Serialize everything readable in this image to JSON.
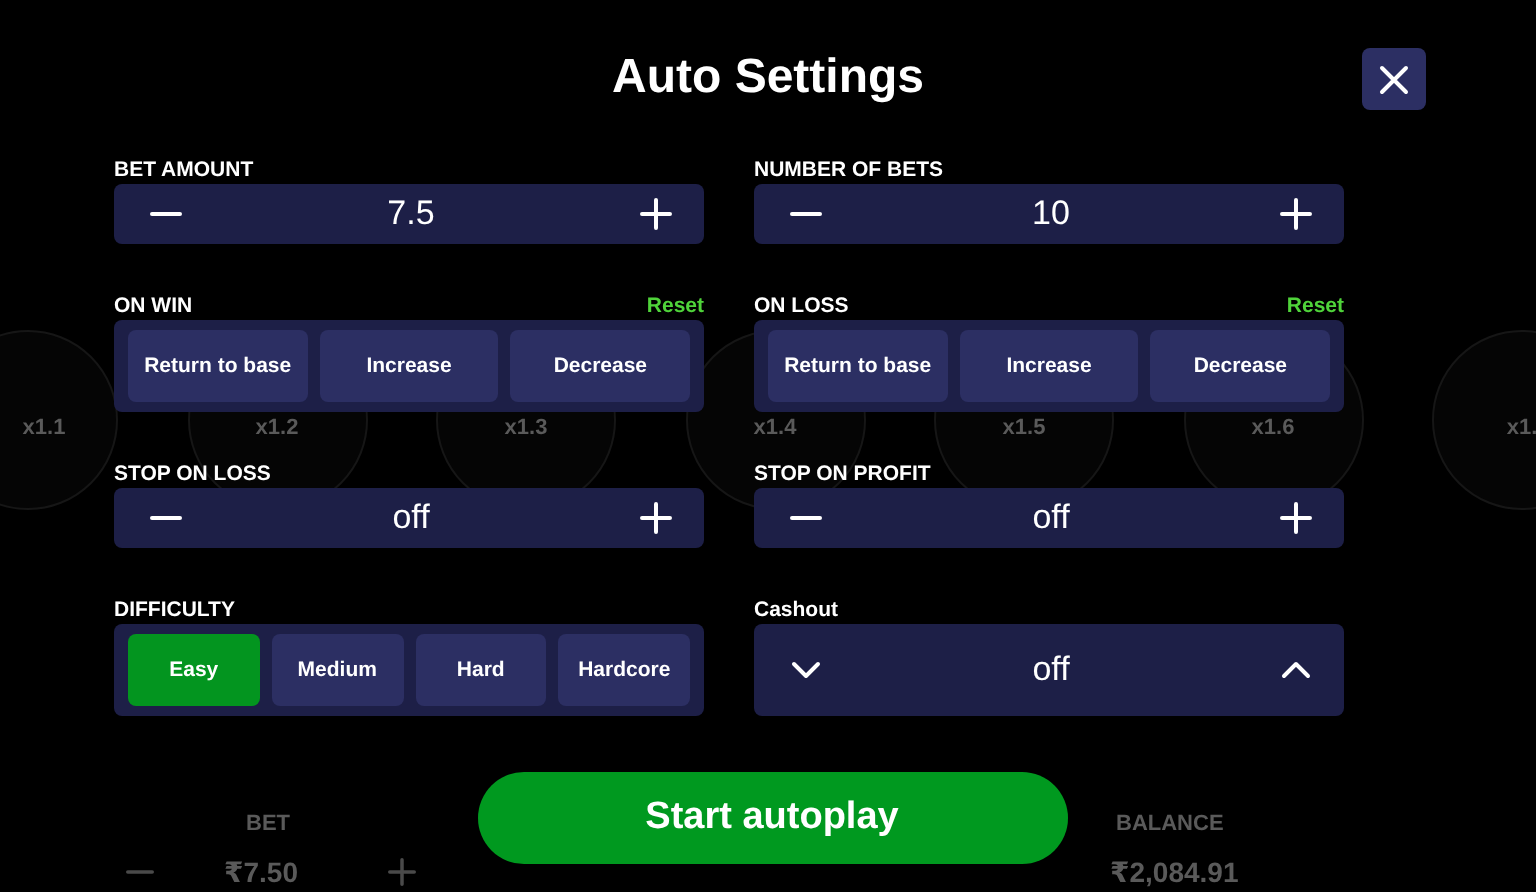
{
  "title": "Auto Settings",
  "sections": [
    {
      "label": "BET AMOUNT",
      "kind": "stepper",
      "value": "7.5"
    },
    {
      "label": "NUMBER OF BETS",
      "kind": "stepper",
      "value": "10"
    },
    {
      "label": "ON WIN",
      "kind": "choice",
      "reset": "Reset",
      "options": [
        {
          "label": "Return to base",
          "selected": false
        },
        {
          "label": "Increase",
          "selected": false
        },
        {
          "label": "Decrease",
          "selected": false
        }
      ]
    },
    {
      "label": "ON LOSS",
      "kind": "choice",
      "reset": "Reset",
      "options": [
        {
          "label": "Return to base",
          "selected": false
        },
        {
          "label": "Increase",
          "selected": false
        },
        {
          "label": "Decrease",
          "selected": false
        }
      ]
    },
    {
      "label": "STOP ON LOSS",
      "kind": "stepper",
      "value": "off"
    },
    {
      "label": "STOP ON PROFIT",
      "kind": "stepper",
      "value": "off"
    },
    {
      "label": "DIFFICULTY",
      "kind": "choice",
      "options": [
        {
          "label": "Easy",
          "selected": true
        },
        {
          "label": "Medium",
          "selected": false
        },
        {
          "label": "Hard",
          "selected": false
        },
        {
          "label": "Hardcore",
          "selected": false
        }
      ]
    },
    {
      "label": "Cashout",
      "kind": "dropdown",
      "value": "off"
    }
  ],
  "start_button": "Start autoplay",
  "background": {
    "multipliers": [
      "x1.1",
      "x1.2",
      "x1.3",
      "x1.4",
      "x1.5",
      "x1.6",
      "x1."
    ],
    "bet_label": "BET",
    "bet_value": "₹7.50",
    "balance_label": "BALANCE",
    "balance_value": "₹2,084.91"
  }
}
